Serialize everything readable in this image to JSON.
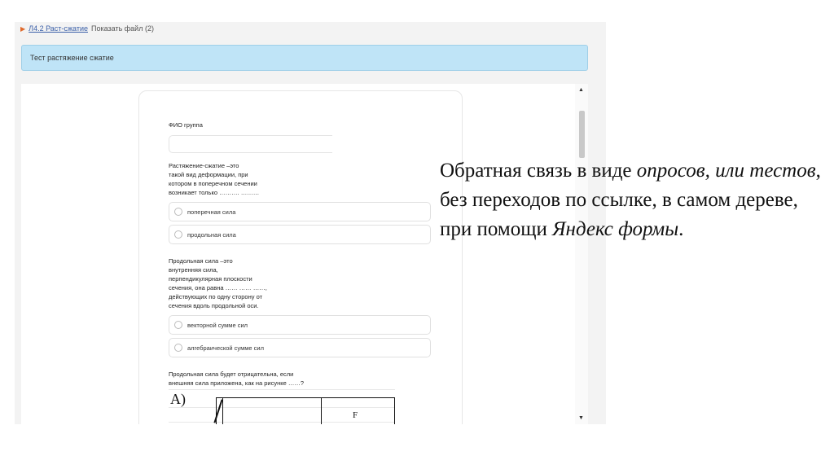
{
  "breadcrumb": {
    "module_link": "Л4.2 Раст-сжатие",
    "show_file": "Показать файл (2)"
  },
  "banner": {
    "text": "Тест растяжение сжатие"
  },
  "form": {
    "fio_label": "ФИО группа",
    "q1": {
      "text": "Растяжение-сжатие –это\nтакой вид деформации, при\nкотором в поперечном сечении\nвозникает только ………. ………",
      "options": [
        "поперечная сила",
        "продольная сила"
      ]
    },
    "q2": {
      "text": "Продольная сила –это\nвнутренняя сила,\nперпендикулярная плоскости\nсечения, она равна …… …… ……,\nдействующих по одну сторону от\nсечения вдоль продольной оси.",
      "options": [
        "векторной сумме сил",
        "алгебраической сумме сил"
      ]
    },
    "q3": {
      "text": "Продольная сила будет отрицательна, если\nвнешняя сила приложена, как на рисунке ……?"
    },
    "figure": {
      "letter": "А)",
      "force": "F"
    }
  },
  "caption": {
    "p1": "Обратная связь в виде ",
    "em1": "опросов,",
    "p2": " ",
    "em2": "или тестов",
    "p3": ", без переходов по ссылке, в самом дереве, при помощи ",
    "em3": "Яндекс формы",
    "p4": "."
  }
}
